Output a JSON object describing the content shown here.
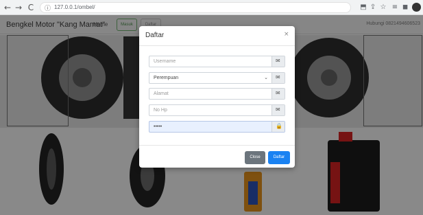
{
  "browser": {
    "url": "127.0.0.1/ombel/",
    "back_icon": "←",
    "forward_icon": "→",
    "reload_icon": "C",
    "info_icon": "ⓘ",
    "toolbar_icons": [
      "⬒",
      "⇪",
      "☆",
      "≡",
      "◼"
    ]
  },
  "navbar": {
    "brand": "Bengkel Motor \"Kang Mamat\"",
    "home": "Home",
    "masuk": "Masuk",
    "daftar": "Daftar",
    "contact": "Hubungi 0821494606523"
  },
  "modal": {
    "title": "Daftar",
    "close_glyph": "×",
    "fields": {
      "username": {
        "placeholder": "Username",
        "icon": "✉"
      },
      "gender": {
        "value": "Perempuan",
        "caret": "⌄",
        "icon": "✉"
      },
      "alamat": {
        "placeholder": "Alamat",
        "icon": "✉"
      },
      "nohp": {
        "placeholder": "No Hp",
        "icon": "✉"
      },
      "password": {
        "value": "•••••",
        "icon": "🔒"
      }
    },
    "btn_close": "Close",
    "btn_daftar": "Daftar"
  },
  "colors": {
    "primary": "#1a82f2",
    "secondary": "#6c757d",
    "success_outline": "#6aa86a"
  }
}
